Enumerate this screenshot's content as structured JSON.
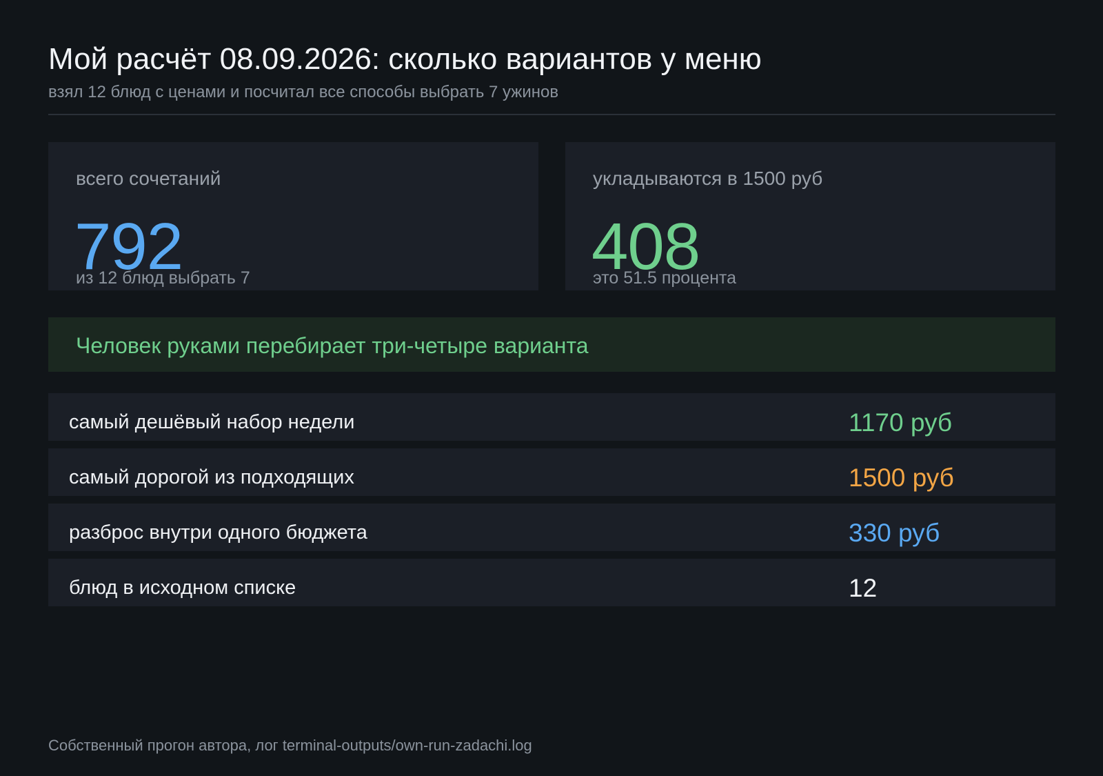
{
  "header": {
    "title": "Мой расчёт 08.09.2026: сколько вариантов у меню",
    "subtitle": "взял 12 блюд с ценами и посчитал все способы выбрать 7 ужинов"
  },
  "stats": [
    {
      "label": "всего сочетаний",
      "value": "792",
      "note": "из 12 блюд выбрать 7",
      "color": "#5aa9f2"
    },
    {
      "label": "укладываются в 1500 руб",
      "value": "408",
      "note": "это 51.5 процента",
      "color": "#6fcf8d"
    }
  ],
  "banner": {
    "text": "Человек руками перебирает три-четыре варианта",
    "color": "#6fcf8d"
  },
  "metrics": [
    {
      "label": "самый дешёвый набор недели",
      "value": "1170 руб",
      "color": "#6fcf8d"
    },
    {
      "label": "самый дорогой из подходящих",
      "value": "1500 руб",
      "color": "#f2a545"
    },
    {
      "label": "разброс внутри одного бюджета",
      "value": "330 руб",
      "color": "#5aa9f2"
    },
    {
      "label": "блюд в исходном списке",
      "value": "12",
      "color": "#f1f3f6"
    }
  ],
  "footer": {
    "text": "Собственный прогон автора, лог terminal-outputs/own-run-zadachi.log"
  }
}
